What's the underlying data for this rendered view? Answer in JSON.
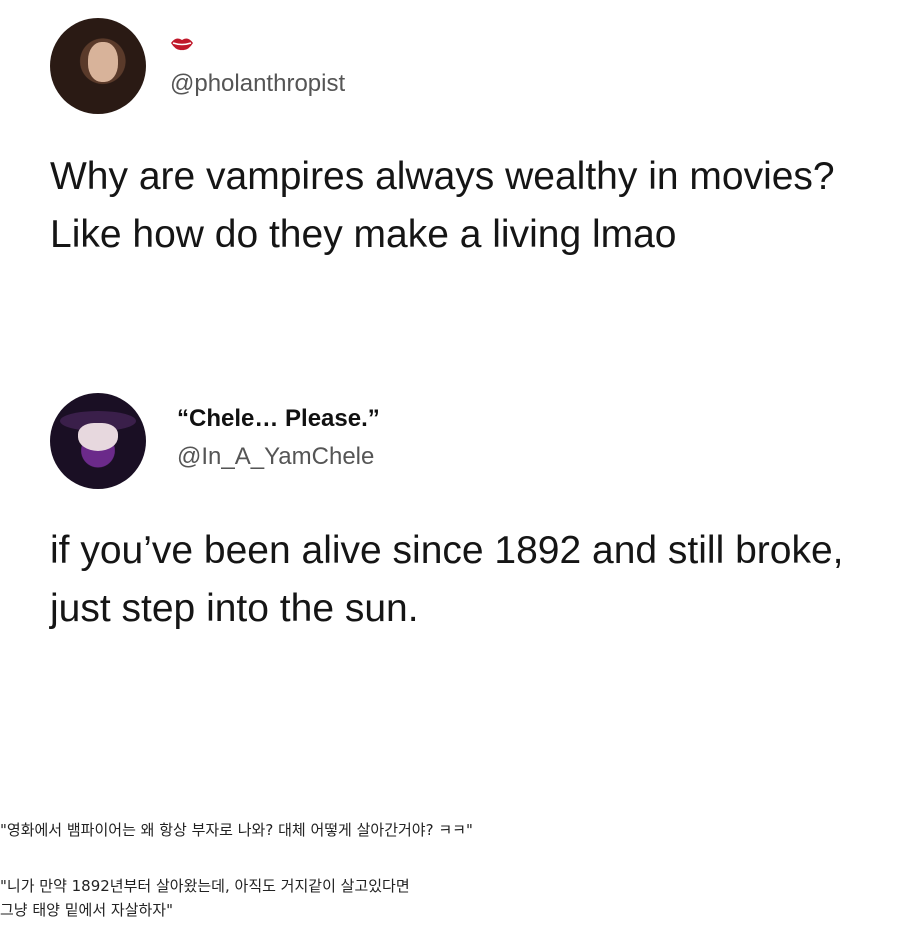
{
  "tweet_1": {
    "display_name_icon": "red-lips-icon",
    "handle": "@pholanthropist",
    "text": "Why are vampires always wealthy in movies? Like how do they make a living lmao"
  },
  "tweet_2": {
    "display_name": "“Chele… Please.”",
    "handle": "@In_A_YamChele",
    "text": "if you’ve been alive since 1892 and still broke, just step into the sun."
  },
  "captions": {
    "line_1": "\"영화에서 뱀파이어는 왜 항상 부자로 나와? 대체 어떻게 살아간거야? ㅋㅋ\"",
    "line_2": "\"니가 만약 1892년부터 살아왔는데, 아직도 거지같이 살고있다면",
    "line_3": "그냥 태양 밑에서 자살하자\""
  },
  "colors": {
    "lips_accent": "#c0182a",
    "handle_text": "#555555",
    "body_text": "#151515"
  }
}
